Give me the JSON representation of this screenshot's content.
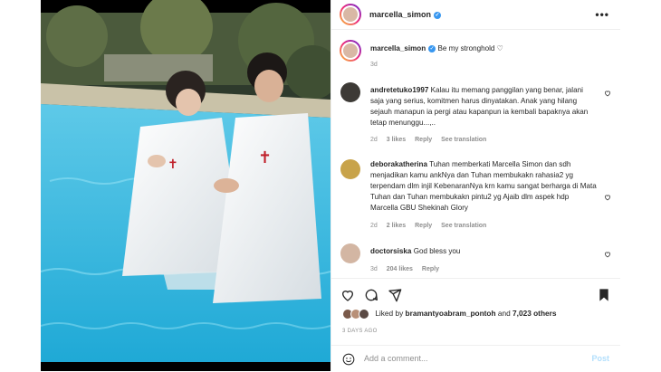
{
  "post": {
    "author": "marcella_simon",
    "verified": true,
    "caption": "Be my stronghold ♡",
    "caption_age": "3d"
  },
  "header": {
    "more_icon": "more-horizontal-icon",
    "more_label": "•••"
  },
  "comments": [
    {
      "user": "andretetuko1997",
      "text": "Kalau itu memang panggilan yang benar, jalani saja yang serius, komitmen harus dinyatakan. Anak yang hilang sejauh manapun ia pergi atau kapanpun ia kembali bapaknya akan tetap menunggu...,..",
      "age": "2d",
      "likes": "3 likes",
      "reply": "Reply",
      "translation": "See translation"
    },
    {
      "user": "deborakatherina",
      "text": "Tuhan memberkati Marcella Simon dan sdh menjadikan kamu ankNya dan Tuhan membukakn rahasia2 yg terpendam dlm injil KebenaranNya krn kamu sangat berharga di Mata Tuhan dan Tuhan membukakn pintu2 yg Ajaib dlm aspek hdp Marcella GBU Shekinah Glory",
      "age": "2d",
      "likes": "2 likes",
      "reply": "Reply",
      "translation": "See translation"
    },
    {
      "user": "doctorsiska",
      "text": "God bless you",
      "age": "3d",
      "likes": "204 likes",
      "reply": "Reply"
    }
  ],
  "actions": {
    "like_icon": "heart-icon",
    "comment_icon": "comment-icon",
    "share_icon": "share-icon",
    "save_icon": "bookmark-icon"
  },
  "likes": {
    "prefix": "Liked by",
    "user": "bramantyoabram_pontoh",
    "conj": "and",
    "others": "7,023 others"
  },
  "posted_ago": "3 DAYS AGO",
  "add_comment": {
    "placeholder": "Add a comment...",
    "post_label": "Post",
    "emoji_icon": "emoji-icon"
  },
  "colors": {
    "verified": "#3897f0",
    "muted": "#8e8e8e",
    "post_disabled": "#b2dffc"
  }
}
